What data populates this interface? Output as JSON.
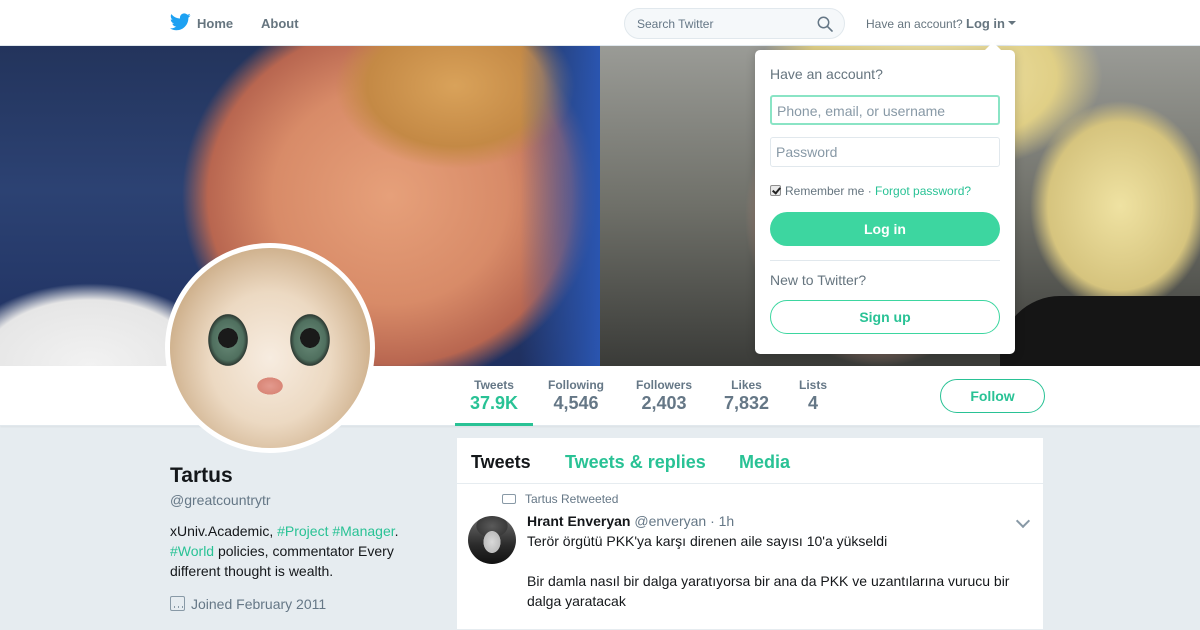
{
  "nav": {
    "home_label": "Home",
    "about_label": "About",
    "search_placeholder": "Search Twitter",
    "have_account": "Have an account?",
    "login_label": "Log in"
  },
  "profile": {
    "name": "Tartus",
    "handle": "@greatcountrytr",
    "bio_text_1": "xUniv.Academic, ",
    "bio_tag_1": "#Project",
    "bio_tag_2": "#Manager",
    "bio_text_2": ".",
    "bio_tag_3": "#World",
    "bio_text_3": " policies, commentator Every different thought is wealth.",
    "joined": "Joined February 2011"
  },
  "stats": [
    {
      "label": "Tweets",
      "value": "37.9K"
    },
    {
      "label": "Following",
      "value": "4,546"
    },
    {
      "label": "Followers",
      "value": "2,403"
    },
    {
      "label": "Likes",
      "value": "7,832"
    },
    {
      "label": "Lists",
      "value": "4"
    }
  ],
  "follow_label": "Follow",
  "timeline": {
    "tabs": [
      "Tweets",
      "Tweets & replies",
      "Media"
    ],
    "tweet": {
      "retweeted_by": "Tartus Retweeted",
      "author": "Hrant Enveryan",
      "handle": "@enveryan",
      "time": "· 1h",
      "text_1": "Terör örgütü PKK'ya karşı direnen aile sayısı 10'a yükseldi",
      "text_2": "Bir damla nasıl bir dalga yaratıyorsa bir ana da PKK ve uzantılarına vurucu bir dalga yaratacak"
    }
  },
  "login_dropdown": {
    "title": "Have an account?",
    "phone_placeholder": "Phone, email, or username",
    "password_placeholder": "Password",
    "remember_me": "Remember me",
    "separator": " · ",
    "forgot_password": "Forgot password?",
    "login_button": "Log in",
    "new_to_twitter": "New to Twitter?",
    "signup_button": "Sign up"
  },
  "colors": {
    "accent": "#29c295",
    "twitter_blue": "#1da1f2"
  }
}
